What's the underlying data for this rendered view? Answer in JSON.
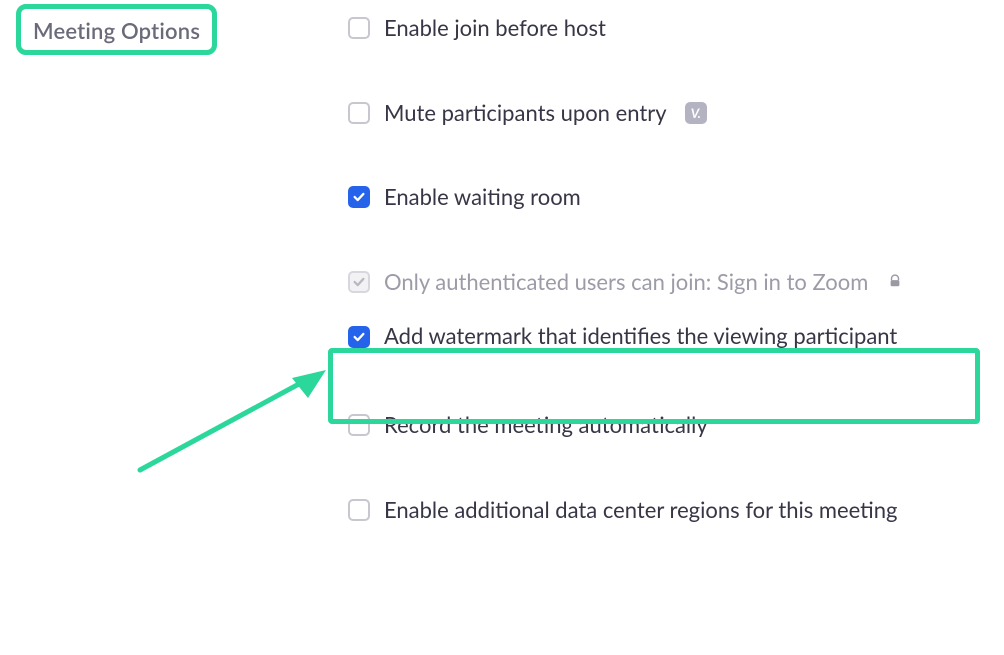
{
  "heading": "Meeting Options",
  "options": [
    {
      "label": "Enable join before host",
      "checked": false,
      "disabled": false,
      "badge": false,
      "lock": false
    },
    {
      "label": "Mute participants upon entry",
      "checked": false,
      "disabled": false,
      "badge": true,
      "lock": false
    },
    {
      "label": "Enable waiting room",
      "checked": true,
      "disabled": false,
      "badge": false,
      "lock": false
    },
    {
      "label": "Only authenticated users can join: Sign in to Zoom",
      "checked": true,
      "disabled": true,
      "badge": false,
      "lock": true
    },
    {
      "label": "Add watermark that identifies the viewing participant",
      "checked": true,
      "disabled": false,
      "badge": false,
      "lock": false
    },
    {
      "label": "Record the meeting automatically",
      "checked": false,
      "disabled": false,
      "badge": false,
      "lock": false
    },
    {
      "label": "Enable additional data center regions for this meeting",
      "checked": false,
      "disabled": false,
      "badge": false,
      "lock": false
    }
  ],
  "badge_text": "V.",
  "annotations": {
    "highlight_color": "#2bd79a"
  }
}
